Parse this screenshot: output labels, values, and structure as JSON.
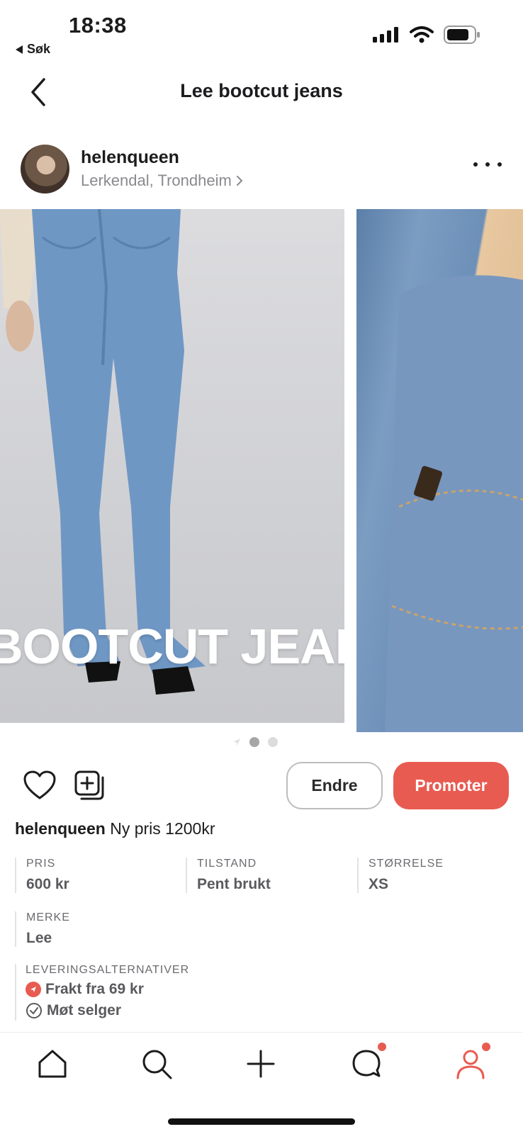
{
  "status_bar": {
    "time": "18:38",
    "back_label": "Søk",
    "icons": [
      "signal-icon",
      "wifi-icon",
      "battery-icon"
    ]
  },
  "header": {
    "title": "Lee bootcut jeans",
    "back_icon": "chevron-left-icon"
  },
  "seller": {
    "name": "helenqueen",
    "location": "Lerkendal, Trondheim"
  },
  "gallery": {
    "overlay_text": "BOOTCUT JEANS",
    "page_count": 2,
    "active_page": 1
  },
  "actions": {
    "edit_label": "Endre",
    "promote_label": "Promoter"
  },
  "caption": {
    "user": "helenqueen",
    "text": "Ny pris 1200kr"
  },
  "attributes": {
    "price": {
      "label": "PRIS",
      "value": "600 kr"
    },
    "condition": {
      "label": "TILSTAND",
      "value": "Pent brukt"
    },
    "size": {
      "label": "STØRRELSE",
      "value": "XS"
    },
    "brand": {
      "label": "MERKE",
      "value": "Lee"
    }
  },
  "delivery": {
    "label": "LEVERINGSALTERNATIVER",
    "shipping": "Frakt fra 69 kr",
    "meet": "Møt selger"
  },
  "tabbar": {
    "items": [
      "home-icon",
      "search-icon",
      "plus-icon",
      "chat-icon",
      "profile-icon"
    ]
  },
  "colors": {
    "accent": "#e85b50",
    "text": "#1c1c1e",
    "muted": "#8a8a8e"
  }
}
